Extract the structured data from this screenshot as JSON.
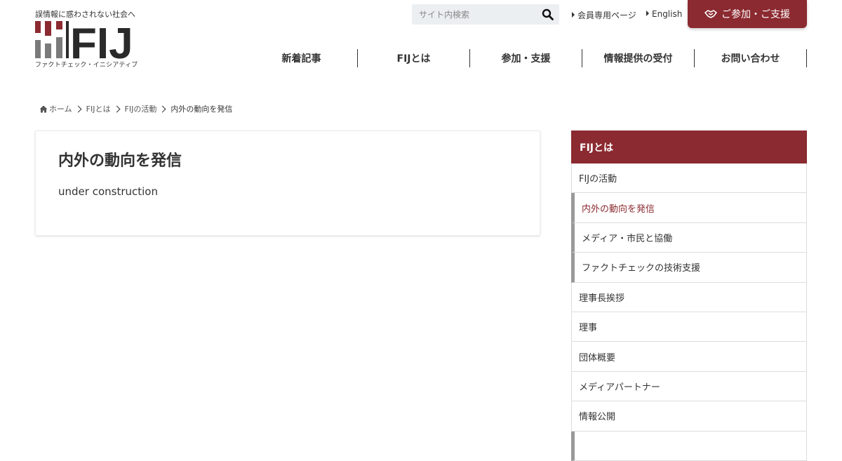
{
  "header": {
    "tagline": "誤情報に惑わされない社会へ",
    "logo_text": "FIJ",
    "logo_sub": "ファクトチェック・イニシアティブ",
    "search": {
      "placeholder": "サイト内検索"
    },
    "member_link": "会員専用ページ",
    "english_link": "English",
    "join_button": "ご参加・ご支援"
  },
  "nav": {
    "items": [
      "新着記事",
      "FIJとは",
      "参加・支援",
      "情報提供の受付",
      "お問い合わせ"
    ]
  },
  "breadcrumb": {
    "items": [
      "ホーム",
      "FIJとは",
      "FIJの活動",
      "内外の動向を発信"
    ]
  },
  "main": {
    "title": "内外の動向を発信",
    "body": "under construction"
  },
  "sidebar": {
    "heading": "FIJとは",
    "items": [
      {
        "label": "FIJの活動"
      },
      {
        "label": "内外の動向を発信"
      },
      {
        "label": "メディア・市民と協働"
      },
      {
        "label": "ファクトチェックの技術支援"
      },
      {
        "label": "理事長挨拶"
      },
      {
        "label": "理事"
      },
      {
        "label": "団体概要"
      },
      {
        "label": "メディアパートナー"
      },
      {
        "label": "情報公開"
      },
      {
        "label": ""
      }
    ]
  },
  "colors": {
    "brand": "#8b2a30",
    "logo_gray": "#7a7a7a",
    "logo_dark": "#2a2a2a",
    "text": "#333333",
    "search_bg": "#eceff2"
  }
}
